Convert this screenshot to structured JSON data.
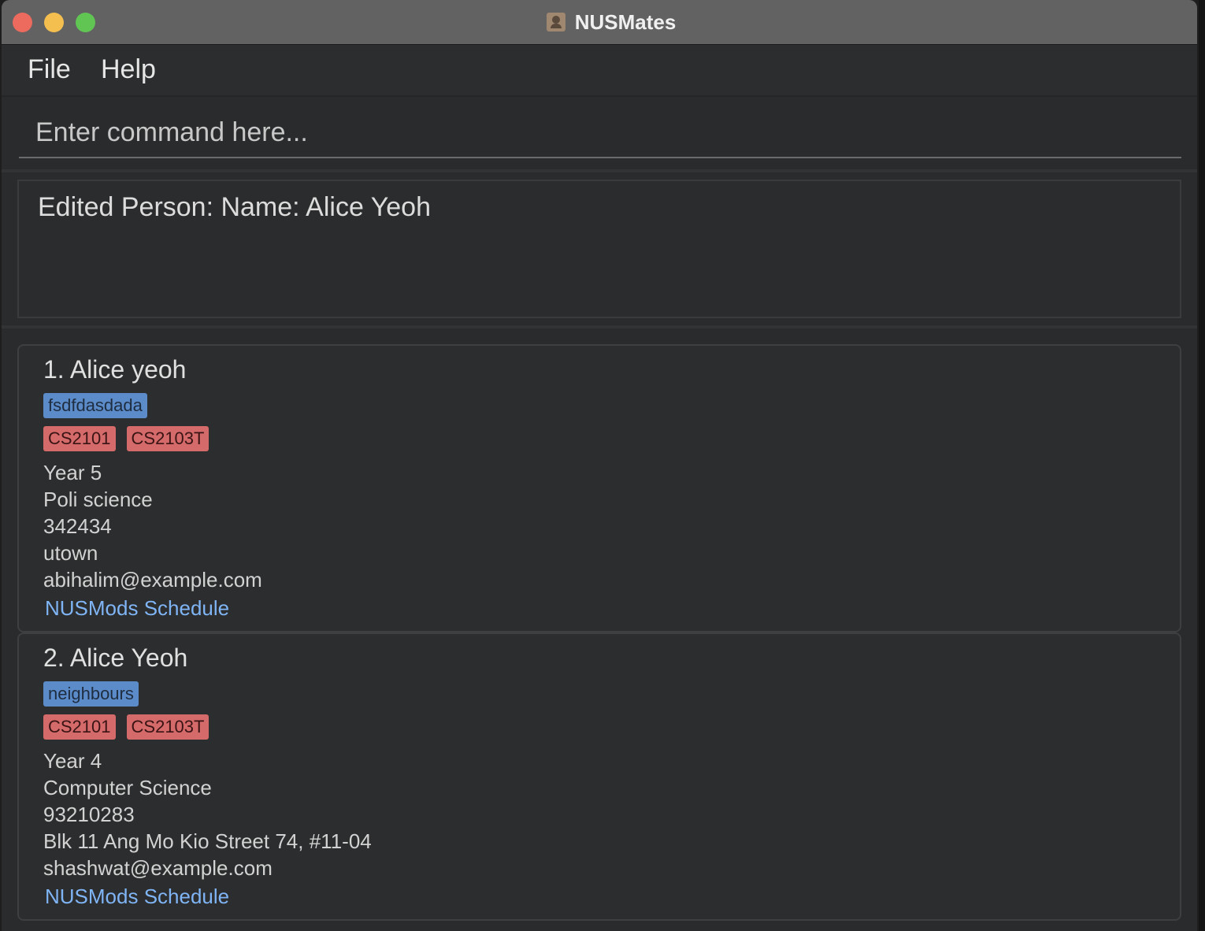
{
  "window": {
    "title": "NUSMates",
    "app_icon": "contact-book-icon"
  },
  "menu": {
    "file_label": "File",
    "help_label": "Help"
  },
  "command": {
    "placeholder": "Enter command here...",
    "value": ""
  },
  "result": {
    "message": "Edited Person: Name: Alice Yeoh"
  },
  "persons": [
    {
      "name": "1. Alice yeoh",
      "groups": [
        "fsdfdasdada"
      ],
      "modules": [
        "CS2101",
        "CS2103T"
      ],
      "year": "Year 5",
      "major": "Poli science",
      "phone": "342434",
      "address": "utown",
      "email": "abihalim@example.com",
      "link": "NUSMods Schedule"
    },
    {
      "name": "2. Alice Yeoh",
      "groups": [
        "neighbours"
      ],
      "modules": [
        "CS2101",
        "CS2103T"
      ],
      "year": "Year 4",
      "major": "Computer Science",
      "phone": "93210283",
      "address": "Blk 11 Ang Mo Kio Street 74, #11-04",
      "email": "shashwat@example.com",
      "link": "NUSMods Schedule"
    }
  ],
  "colors": {
    "group_tag": "#5b8bc9",
    "module_tag": "#d46a6a",
    "link": "#7fb4f5",
    "background": "#2a2b2c"
  }
}
